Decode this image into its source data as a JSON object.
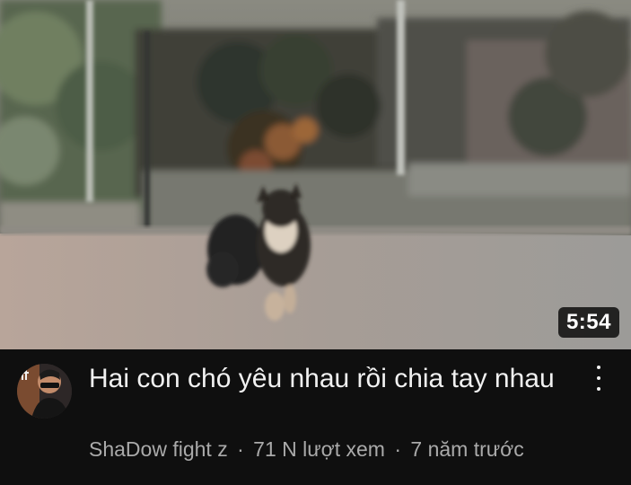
{
  "video": {
    "duration": "5:54",
    "title": "Hai con chó yêu nhau rồi chia tay nhau",
    "channel": "ShaDow fight z",
    "views": "71 N lượt xem",
    "age": "7 năm trước",
    "separator": "·"
  },
  "icons": {
    "more": "vertical-ellipsis-icon",
    "avatar": "channel-avatar"
  },
  "colors": {
    "background": "#0f0f0f",
    "title_text": "#f1f1f1",
    "meta_text": "#aaaaaa",
    "badge_background": "#000000"
  }
}
